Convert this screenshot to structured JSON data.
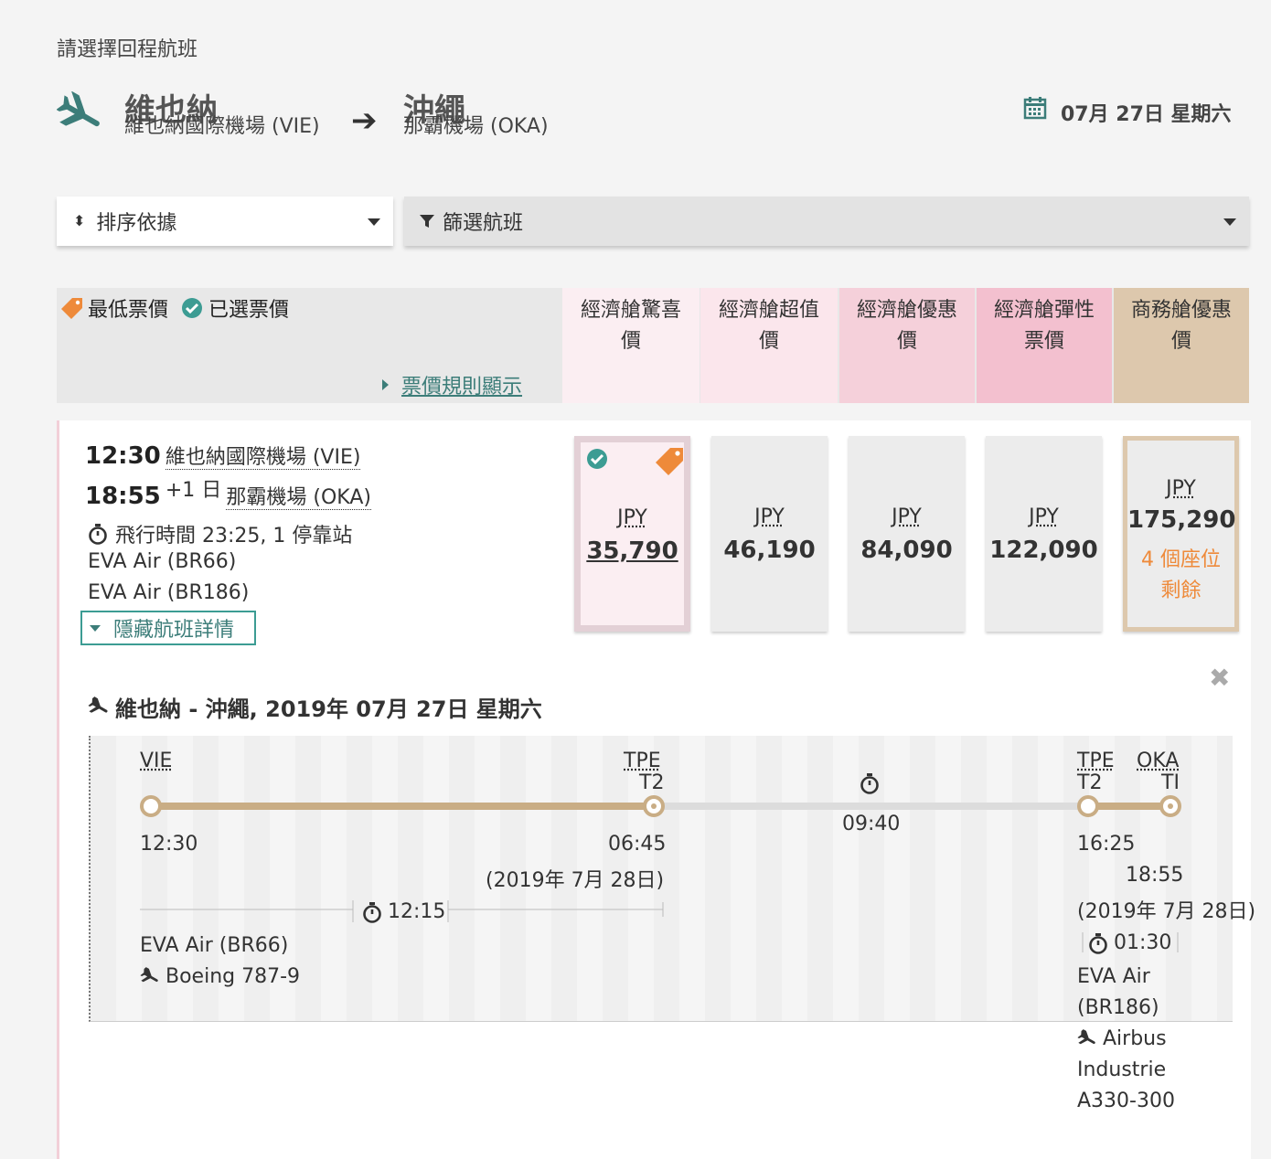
{
  "header": {
    "step_title": "請選擇回程航班",
    "origin_city": "維也納",
    "origin_airport": "維也納國際機場 (VIE)",
    "dest_city": "沖繩",
    "dest_airport": "那霸機場 (OKA)",
    "date": "07月 27日 星期六"
  },
  "controls": {
    "sort_label": "排序依據",
    "filter_label": "篩選航班"
  },
  "legend": {
    "lowest": "最低票價",
    "selected": "已選票價",
    "rules_link": "票價規則顯示"
  },
  "fare_columns": [
    {
      "line1": "經濟艙驚喜",
      "line2": "價"
    },
    {
      "line1": "經濟艙超值",
      "line2": "價"
    },
    {
      "line1": "經濟艙優惠",
      "line2": "價"
    },
    {
      "line1": "經濟艙彈性",
      "line2": "票價"
    },
    {
      "line1": "商務艙優惠",
      "line2": "價"
    }
  ],
  "flight": {
    "dep_time": "12:30",
    "dep_airport": "維也納國際機場 (VIE)",
    "arr_time": "18:55",
    "arr_offset": "+1 日",
    "arr_airport": "那霸機場 (OKA)",
    "duration": "飛行時間 23:25, 1 停靠站",
    "carrier1": "EVA Air (BR66)",
    "carrier2": "EVA Air (BR186)",
    "hide_details": "隱藏航班詳情"
  },
  "prices": [
    {
      "currency": "JPY",
      "amount": "35,790"
    },
    {
      "currency": "JPY",
      "amount": "46,190"
    },
    {
      "currency": "JPY",
      "amount": "84,090"
    },
    {
      "currency": "JPY",
      "amount": "122,090"
    },
    {
      "currency": "JPY",
      "amount": "175,290",
      "seats_line1": "4 個座位",
      "seats_line2": "剩餘"
    }
  ],
  "details": {
    "title": "維也納 - 沖繩, 2019年 07月 27日 星期六",
    "vie": "VIE",
    "tpe1": "TPE",
    "tpe1_terminal": "T2",
    "tpe2": "TPE",
    "tpe2_terminal": "T2",
    "oka": "OKA",
    "oka_terminal": "TI",
    "dep_time": "12:30",
    "tpe_arr": "06:45",
    "tpe_arr_date": "(2019年 7月 28日)",
    "layover": "09:40",
    "tpe_dep": "16:25",
    "oka_arr": "18:55",
    "oka_arr_date": "(2019年 7月 28日)",
    "seg1_duration": "12:15",
    "seg2_duration": "01:30",
    "seg1_carrier": "EVA Air (BR66)",
    "seg1_aircraft": "Boeing 787-9",
    "seg2_carrier_l1": "EVA Air",
    "seg2_carrier_l2": "(BR186)",
    "seg2_aircraft_l1": "Airbus",
    "seg2_aircraft_l2": "Industrie",
    "seg2_aircraft_l3": "A330-300"
  },
  "colors": {
    "accent_teal": "#3c7d79",
    "tag_orange": "#ee8a3a",
    "timeline_gold": "#c9ad85",
    "business_tan": "#ddc8ad",
    "pink_light": "#fbeef2",
    "pink_mid": "#f5d0da",
    "pink_deep": "#f3c0cf"
  }
}
